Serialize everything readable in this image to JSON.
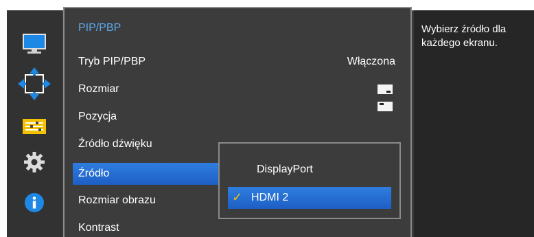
{
  "rail": {
    "icons": [
      "monitor-icon",
      "move-arrows-icon",
      "sliders-icon",
      "gear-icon",
      "info-icon"
    ]
  },
  "menu": {
    "title": "PIP/PBP",
    "items": [
      {
        "label": "Tryb PIP/PBP",
        "value": "Włączona"
      },
      {
        "label": "Rozmiar"
      },
      {
        "label": "Pozycja"
      },
      {
        "label": "Źródło dźwięku"
      },
      {
        "label": "Źródło"
      },
      {
        "label": "Rozmiar obrazu"
      },
      {
        "label": "Kontrast"
      }
    ],
    "selected_index": 4
  },
  "submenu": {
    "options": [
      {
        "label": "DisplayPort",
        "checked": false
      },
      {
        "label": "HDMI 2",
        "checked": true
      }
    ],
    "check_glyph": "✓"
  },
  "help": {
    "text": "Wybierz źródło dla każdego ekranu."
  },
  "colors": {
    "title": "#5aa9f0",
    "highlight": "#2f7de0",
    "check": "#f2c200",
    "icon_blue": "#1e88e5"
  }
}
